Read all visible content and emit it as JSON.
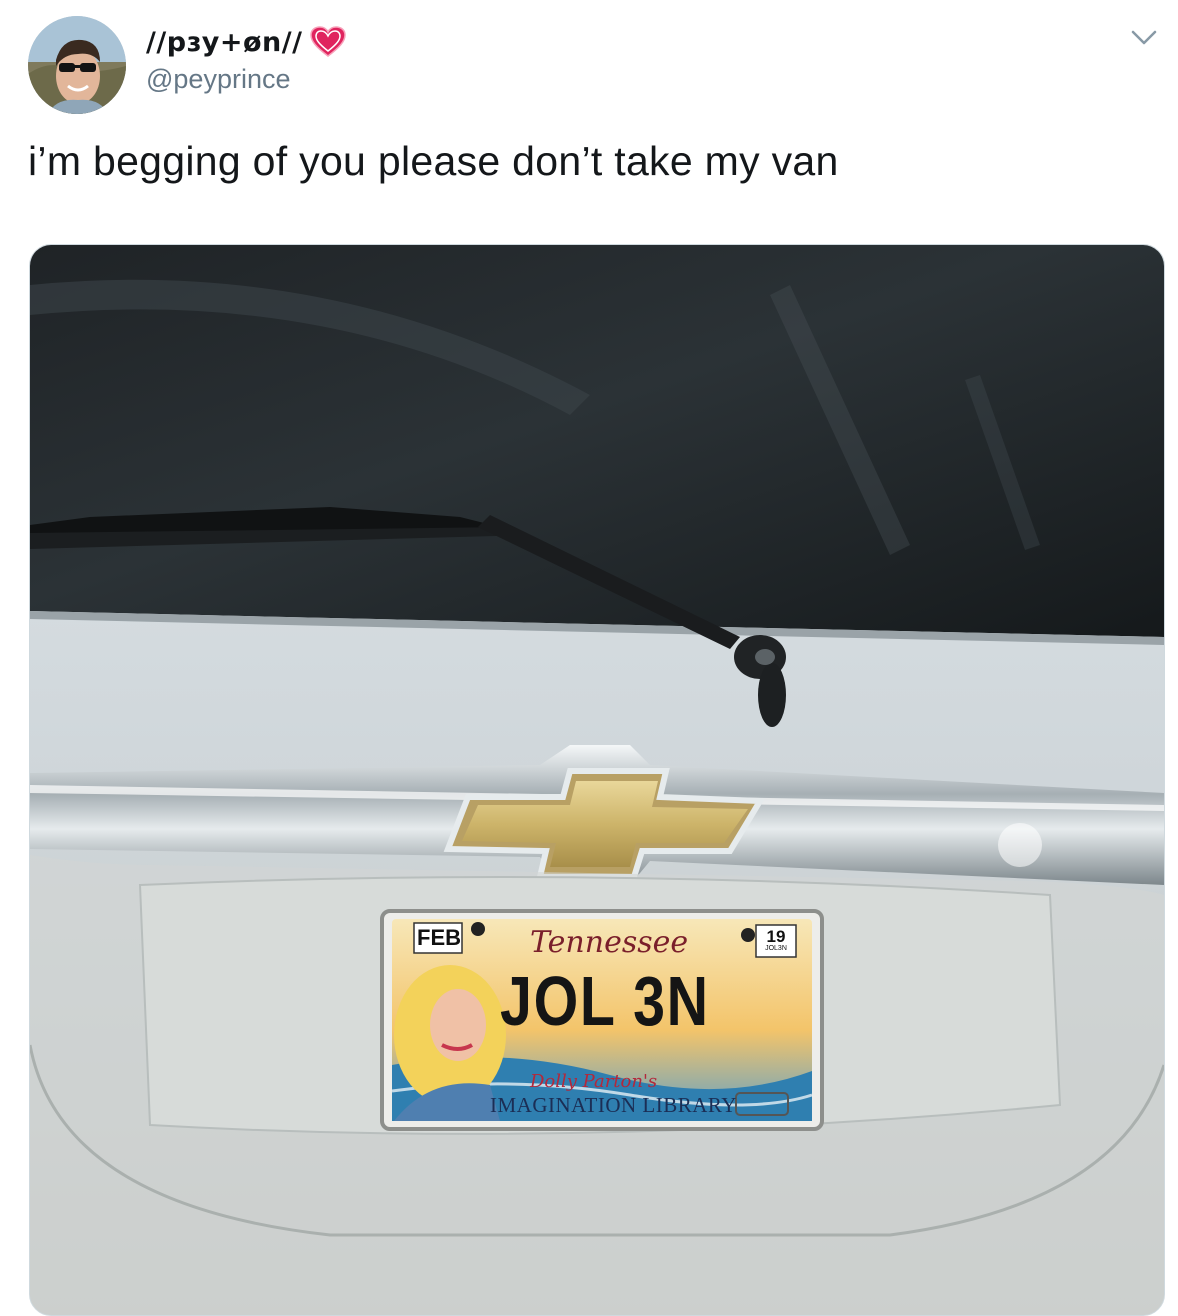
{
  "user": {
    "display_name": "//pɜy+øn//",
    "handle": "@peyprince",
    "avatar_icon": "avatar-photo",
    "badge_icon": "heart-icon"
  },
  "tweet": {
    "text": "i’m begging of you please don’t take my van"
  },
  "menu": {
    "icon": "chevron-down-icon"
  },
  "media": {
    "plate": {
      "month": "FEB",
      "state": "Tennessee",
      "year": "19",
      "sticker_code": "JOL3N",
      "number": "JOL 3N",
      "sponsor_line1": "Dolly Parton's",
      "sponsor_line2": "IMAGINATION LIBRARY"
    }
  },
  "colors": {
    "text_primary": "#14171a",
    "text_secondary": "#657786",
    "heart": "#e0245e",
    "border": "#cfd9de"
  }
}
